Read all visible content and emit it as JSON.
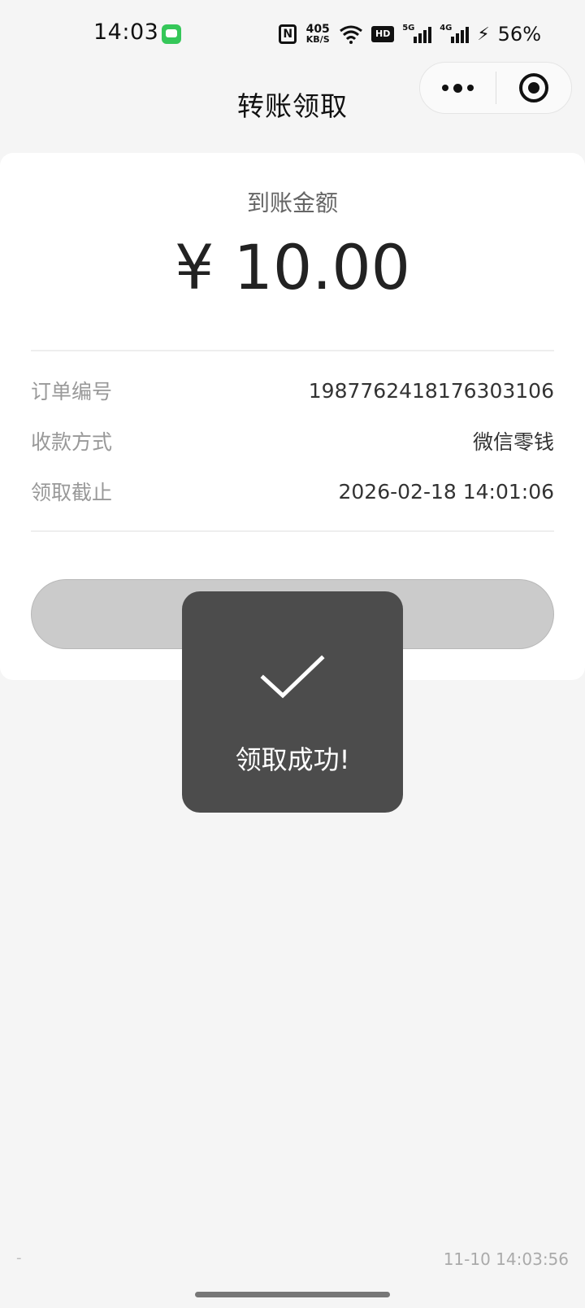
{
  "status_bar": {
    "time": "14:03",
    "net_speed_value": "405",
    "net_speed_unit": "KB/S",
    "hd_label": "HD",
    "signal1_tag": "5G",
    "signal2_tag": "4G",
    "battery": "56%"
  },
  "nav": {
    "title": "转账领取"
  },
  "card": {
    "amount_label": "到账金额",
    "amount": "¥ 10.00",
    "rows": [
      {
        "key": "订单编号",
        "value": "1987762418176303106"
      },
      {
        "key": "收款方式",
        "value": "微信零钱"
      },
      {
        "key": "领取截止",
        "value": "2026-02-18 14:01:06"
      }
    ]
  },
  "toast": {
    "text": "领取成功!"
  },
  "footer": {
    "left": "-",
    "timestamp": "11-10 14:03:56"
  },
  "colors": {
    "background": "#f5f5f5",
    "card": "#ffffff",
    "button_disabled": "#cbcbcb",
    "toast_bg": "#4c4c4c",
    "notif_green": "#35c759"
  }
}
